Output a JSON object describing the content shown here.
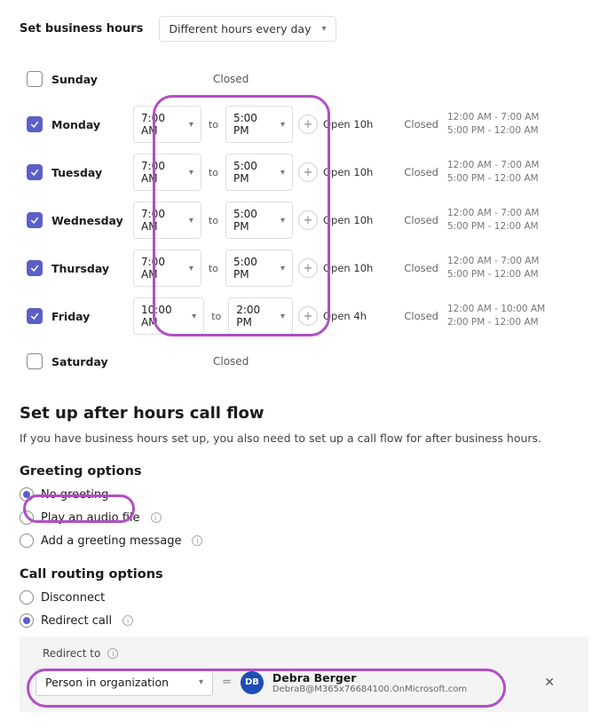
{
  "businessHours": {
    "label": "Set business hours",
    "mode": "Different hours every day",
    "days": [
      {
        "name": "Sunday",
        "enabled": false,
        "closedLabel": "Closed"
      },
      {
        "name": "Monday",
        "enabled": true,
        "start": "7:00 AM",
        "end": "5:00 PM",
        "openText": "Open 10h",
        "closedHeader": "Closed",
        "span1": "12:00 AM - 7:00 AM",
        "span2": "5:00 PM - 12:00 AM"
      },
      {
        "name": "Tuesday",
        "enabled": true,
        "start": "7:00 AM",
        "end": "5:00 PM",
        "openText": "Open 10h",
        "closedHeader": "Closed",
        "span1": "12:00 AM - 7:00 AM",
        "span2": "5:00 PM - 12:00 AM"
      },
      {
        "name": "Wednesday",
        "enabled": true,
        "start": "7:00 AM",
        "end": "5:00 PM",
        "openText": "Open 10h",
        "closedHeader": "Closed",
        "span1": "12:00 AM - 7:00 AM",
        "span2": "5:00 PM - 12:00 AM"
      },
      {
        "name": "Thursday",
        "enabled": true,
        "start": "7:00 AM",
        "end": "5:00 PM",
        "openText": "Open 10h",
        "closedHeader": "Closed",
        "span1": "12:00 AM - 7:00 AM",
        "span2": "5:00 PM - 12:00 AM"
      },
      {
        "name": "Friday",
        "enabled": true,
        "start": "10:00 AM",
        "end": "2:00 PM",
        "openText": "Open 4h",
        "closedHeader": "Closed",
        "span1": "12:00 AM - 10:00 AM",
        "span2": "2:00 PM - 12:00 AM"
      },
      {
        "name": "Saturday",
        "enabled": false,
        "closedLabel": "Closed"
      }
    ],
    "to": "to"
  },
  "afterHours": {
    "heading": "Set up after hours call flow",
    "description": "If you have business hours set up, you also need to set up a call flow for after business hours."
  },
  "greeting": {
    "heading": "Greeting options",
    "options": {
      "noGreeting": "No greeting",
      "audioFile": "Play an audio file",
      "message": "Add a greeting message"
    },
    "selected": "noGreeting"
  },
  "routing": {
    "heading": "Call routing options",
    "options": {
      "disconnect": "Disconnect",
      "redirect": "Redirect call"
    },
    "selected": "redirect",
    "redirect": {
      "label": "Redirect to",
      "targetType": "Person in organization",
      "person": {
        "initials": "DB",
        "name": "Debra Berger",
        "email": "DebraB@M365x76684100.OnMicrosoft.com"
      }
    }
  }
}
